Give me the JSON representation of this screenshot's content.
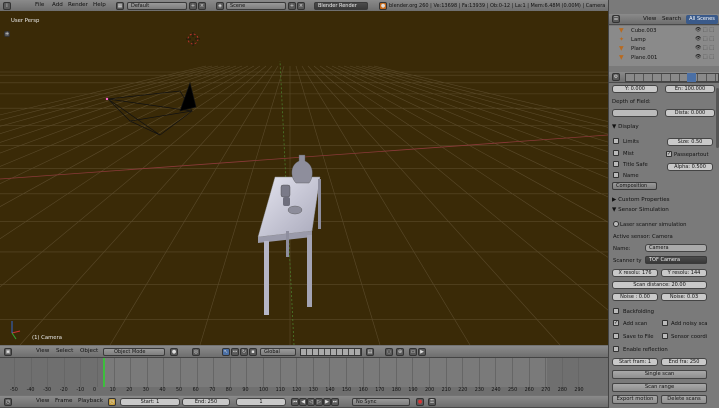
{
  "top_header": {
    "menu": [
      "File",
      "Add",
      "Render",
      "Help"
    ],
    "layout_name": "Default",
    "scene_name": "Scene",
    "render_engine": "Blender Render",
    "info": "blender.org 260 | Ve:13698 | Fa:13939 | Ob:0-12 | La:1 | Mem:6.48M (0.00M) | Camera"
  },
  "viewport": {
    "view_label": "User Persp",
    "object_label": "(1) Camera",
    "colors": {
      "background": "#3a2a07",
      "grid": "#5a4a2a",
      "x_axis": "#8b3a3a",
      "y_axis": "#4a7a2a",
      "table": "#c8c8d8"
    }
  },
  "viewport_header": {
    "menu": [
      "View",
      "Select",
      "Object"
    ],
    "mode": "Object Mode",
    "orientation": "Global"
  },
  "timeline": {
    "ticks": [
      "-50",
      "-40",
      "-30",
      "-20",
      "-10",
      "0",
      "10",
      "20",
      "30",
      "40",
      "50",
      "60",
      "70",
      "80",
      "90",
      "100",
      "110",
      "120",
      "130",
      "140",
      "150",
      "160",
      "170",
      "180",
      "190",
      "200",
      "210",
      "220",
      "230",
      "240",
      "250",
      "260",
      "270",
      "280",
      "290"
    ],
    "menu": [
      "View",
      "Frame",
      "Playback"
    ],
    "start": "Start: 1",
    "end": "End: 250",
    "current": "1",
    "sync": "No Sync"
  },
  "outliner": {
    "tabs": [
      "View",
      "Search",
      "All Scenes"
    ],
    "items": [
      "Cube.003",
      "Lamp",
      "Plane",
      "Plane.001"
    ]
  },
  "properties": {
    "field_y": "Y: 0.000",
    "field_en": "En: 100.000",
    "depth_of_field": "Depth of Field:",
    "dista": "Dista: 0.000",
    "display_header": "Display",
    "limits": "Limits",
    "size": "Size: 0.50",
    "mist": "Mist",
    "passepartout": "Passepartout",
    "title_safe": "Title Safe",
    "alpha": "Alpha: 0.500",
    "name": "Name",
    "composition": "Composition",
    "custom_properties": "Custom Properties",
    "sensor_simulation": "Sensor Simulation",
    "laser_scanner": "Laser scanner simulation",
    "active_sensor": "Active sensor: Camera",
    "name_label": "Name:",
    "name_value": "Camera",
    "scanner_type_label": "Scanner ty",
    "scanner_type": "TOF Camera",
    "x_resolu": "X resolu: 176",
    "y_resolu": "Y resolu: 144",
    "scan_distance": "Scan distance: 20.00",
    "noise1": "Noise : 0.00",
    "noise2": "Noise: 0.03",
    "backfolding": "Backfolding",
    "add_scan": "Add scan",
    "add_noisy_scan": "Add noisy sca",
    "save_to_file": "Save to File",
    "sensor_coordi": "Sensor coordi",
    "enable_reflection": "Enable reflection",
    "start_fram": "Start fram: 1",
    "end_fra": "End fra: 250",
    "single_scan": "Single scan",
    "scan_range": "Scan range",
    "export_motion": "Export motion",
    "delete_scans": "Delete scans"
  }
}
